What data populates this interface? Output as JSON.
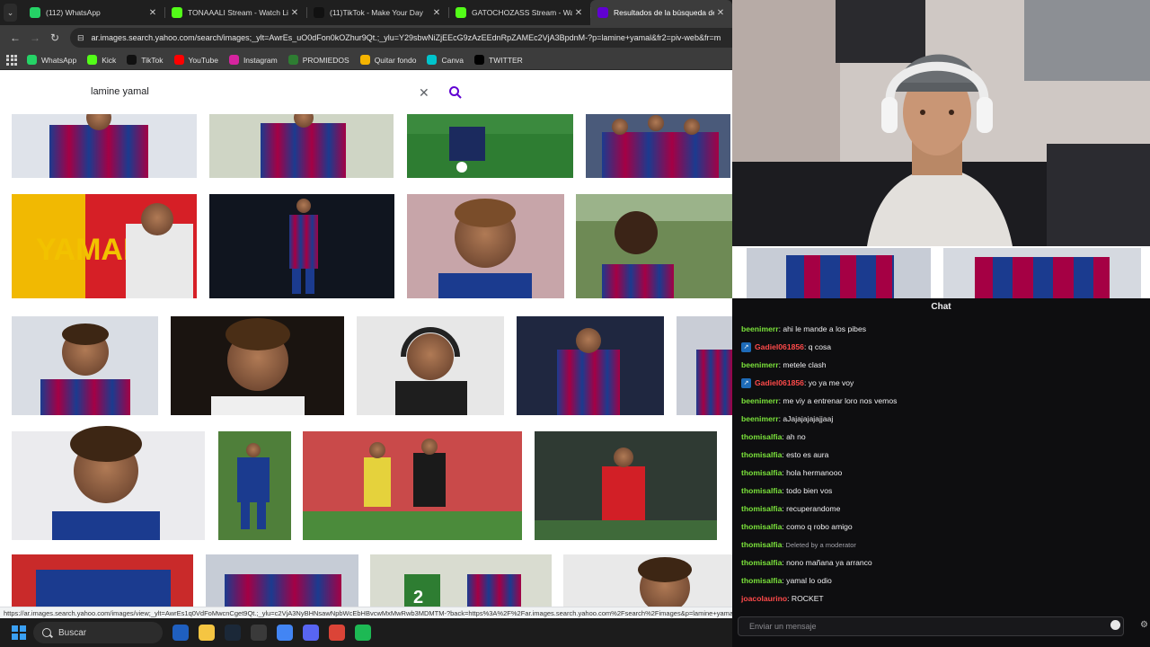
{
  "browser": {
    "tabs": [
      {
        "title": "(112) WhatsApp",
        "favicon_color": "#25d366",
        "favicon_icon": "whatsapp-icon",
        "active": false
      },
      {
        "title": "TONAAALI Stream - Watch Live",
        "favicon_color": "#53fc18",
        "favicon_icon": "kick-icon",
        "active": false
      },
      {
        "title": "(11)TikTok - Make Your Day",
        "favicon_color": "#111111",
        "favicon_icon": "tiktok-icon",
        "active": false
      },
      {
        "title": "GATOCHOZASS Stream - Watch",
        "favicon_color": "#53fc18",
        "favicon_icon": "kick-icon",
        "active": false
      },
      {
        "title": "Resultados de la búsqueda de",
        "favicon_color": "#6001d2",
        "favicon_icon": "yahoo-icon",
        "active": true
      }
    ],
    "url": "ar.images.search.yahoo.com/search/images;_ylt=AwrEs_uO0dFon0kOZhur9Qt.;_ylu=Y29sbwNiZjEEcG9zAzEEdnRpZAMEc2VjA3BpdnM-?p=lamine+yamal&fr2=piv-web&fr=m",
    "bookmarks": [
      {
        "label": "WhatsApp",
        "icon": "whatsapp-icon",
        "color": "#25d366"
      },
      {
        "label": "Kick",
        "icon": "kick-icon",
        "color": "#53fc18"
      },
      {
        "label": "TikTok",
        "icon": "tiktok-icon",
        "color": "#111111"
      },
      {
        "label": "YouTube",
        "icon": "youtube-icon",
        "color": "#ff0000"
      },
      {
        "label": "Instagram",
        "icon": "instagram-icon",
        "color": "#d6249f"
      },
      {
        "label": "PROMIEDOS",
        "icon": "promiedos-icon",
        "color": "#2e7d32"
      },
      {
        "label": "Quitar fondo",
        "icon": "removebg-icon",
        "color": "#f4b400"
      },
      {
        "label": "Canva",
        "icon": "canva-icon",
        "color": "#00c4cc"
      },
      {
        "label": "TWITTER",
        "icon": "x-icon",
        "color": "#000000"
      }
    ]
  },
  "search": {
    "query": "lamine yamal",
    "accent": "#6001d2"
  },
  "status_url": "https://ar.images.search.yahoo.com/images/view;_ylt=AwrEs1q0VdFoMwcnCget9Qt.;_ylu=c2VjA3NyBHNsawNpbWcEbHBvcwMxMwRwb3MDMTM-?back=https%3A%2F%2Far.images.search.yahoo.com%2Fsearch%2Fimages&p=lamine+yamal&imgurl=ROMD4MWpWB1ZmYmJ&tt=IMXYEaXQDYmluZw--?back=https%3",
  "chat": {
    "title": "Chat",
    "input_placeholder": "Enviar un mensaje",
    "messages": [
      {
        "user": "beenimerr",
        "user_color": "#7be33b",
        "text": ": ahi le mande a los pibes",
        "badge": false,
        "mod": false
      },
      {
        "user": "Gadiel061856",
        "user_color": "#ff4a4a",
        "text": ": q cosa",
        "badge": true,
        "mod": false
      },
      {
        "user": "beenimerr",
        "user_color": "#7be33b",
        "text": ": metele clash",
        "badge": false,
        "mod": false
      },
      {
        "user": "Gadiel061856",
        "user_color": "#ff4a4a",
        "text": ": yo ya me voy",
        "badge": true,
        "mod": false
      },
      {
        "user": "beenimerr",
        "user_color": "#7be33b",
        "text": ": me viy a entrenar loro nos vemos",
        "badge": false,
        "mod": false
      },
      {
        "user": "beenimerr",
        "user_color": "#7be33b",
        "text": ": aJajajajajajjaaj",
        "badge": false,
        "mod": false
      },
      {
        "user": "thomisalfia",
        "user_color": "#7be33b",
        "text": ": ah no",
        "badge": false,
        "mod": false
      },
      {
        "user": "thomisalfia",
        "user_color": "#7be33b",
        "text": ": esto es aura",
        "badge": false,
        "mod": false
      },
      {
        "user": "thomisalfia",
        "user_color": "#7be33b",
        "text": ": hola hermanooo",
        "badge": false,
        "mod": false
      },
      {
        "user": "thomisalfia",
        "user_color": "#7be33b",
        "text": ": todo bien vos",
        "badge": false,
        "mod": false
      },
      {
        "user": "thomisalfia",
        "user_color": "#7be33b",
        "text": ": recuperandome",
        "badge": false,
        "mod": false
      },
      {
        "user": "thomisalfia",
        "user_color": "#7be33b",
        "text": ": como q robo amigo",
        "badge": false,
        "mod": false
      },
      {
        "user": "thomisalfia",
        "user_color": "#7be33b",
        "text": ": Deleted by a moderator",
        "badge": false,
        "mod": true
      },
      {
        "user": "thomisalfia",
        "user_color": "#7be33b",
        "text": ": nono mañana ya arranco",
        "badge": false,
        "mod": false
      },
      {
        "user": "thomisalfia",
        "user_color": "#7be33b",
        "text": ": yamal lo odio",
        "badge": false,
        "mod": false
      },
      {
        "user": "joacolaurino",
        "user_color": "#ff4a4a",
        "text": ": ROCKET",
        "badge": false,
        "mod": false
      }
    ]
  },
  "taskbar": {
    "search_label": "Buscar",
    "apps": [
      {
        "icon": "settings-icon",
        "color": "#1f5fbf"
      },
      {
        "icon": "file-explorer-icon",
        "color": "#f5c542"
      },
      {
        "icon": "steam-icon",
        "color": "#1b2838"
      },
      {
        "icon": "chatgpt-icon",
        "color": "#3a3a3a"
      },
      {
        "icon": "chrome-icon",
        "color": "#4285f4"
      },
      {
        "icon": "discord-icon",
        "color": "#5865f2"
      },
      {
        "icon": "chrome-profile-icon",
        "color": "#db4437"
      },
      {
        "icon": "spotify-icon",
        "color": "#1db954"
      }
    ]
  }
}
